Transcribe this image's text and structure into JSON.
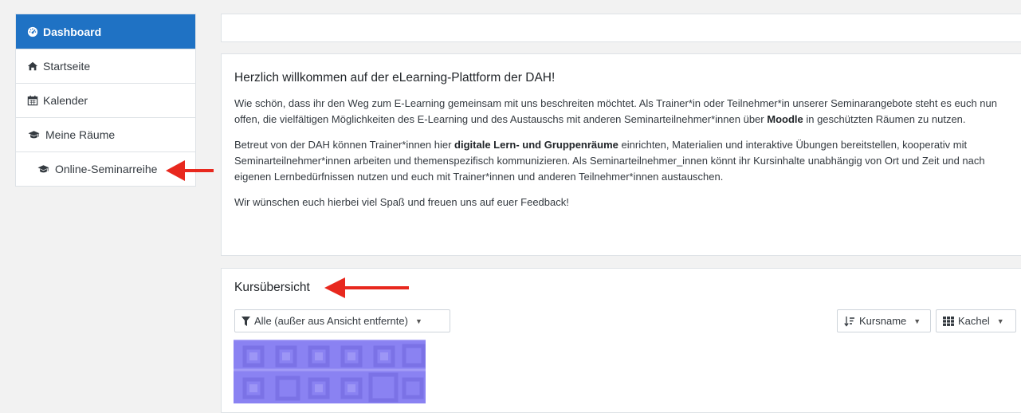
{
  "sidebar": {
    "items": [
      {
        "label": "Dashboard",
        "icon": "tachometer-icon",
        "active": true
      },
      {
        "label": "Startseite",
        "icon": "home-icon"
      },
      {
        "label": "Kalender",
        "icon": "calendar-icon"
      },
      {
        "label": "Meine Räume",
        "icon": "graduation-cap-icon"
      },
      {
        "label": "Online-Seminarreihe",
        "icon": "graduation-cap-icon"
      }
    ]
  },
  "welcome": {
    "title": "Herzlich willkommen auf der eLearning-Plattform der DAH!",
    "p1_a": "Wie schön, dass ihr den Weg zum E-Learning gemeinsam mit uns beschreiten möchtet. Als Trainer*in oder Teilnehmer*in unserer Seminarangebote steht es euch nun offen, die vielfältigen Möglichkeiten des E-Learning und des Austauschs mit anderen Seminarteilnehmer*innen über ",
    "p1_bold": "Moodle",
    "p1_b": " in geschützten Räumen zu nutzen.",
    "p2_a": "Betreut von der DAH können Trainer*innen hier ",
    "p2_bold": "digitale Lern- und Gruppenräume",
    "p2_b": " einrichten, Materialien und interaktive Übungen bereitstellen, kooperativ mit Seminarteilnehmer*innen arbeiten und themenspezifisch kommunizieren. Als Seminarteilnehmer_innen könnt ihr Kursinhalte unabhängig von Ort und Zeit und nach eigenen Lernbedürfnissen nutzen und euch mit Trainer*innen und anderen Teilnehmer*innen austauschen.",
    "p3": "Wir wünschen euch hierbei viel Spaß und freuen uns auf euer Feedback!"
  },
  "courses": {
    "title": "Kursübersicht",
    "filter_label": "Alle (außer aus Ansicht entfernte)",
    "sort_label": "Kursname",
    "view_label": "Kachel"
  },
  "colors": {
    "accent": "#1f72c4",
    "arrow": "#e8281e",
    "tile": "#8a82f2"
  }
}
